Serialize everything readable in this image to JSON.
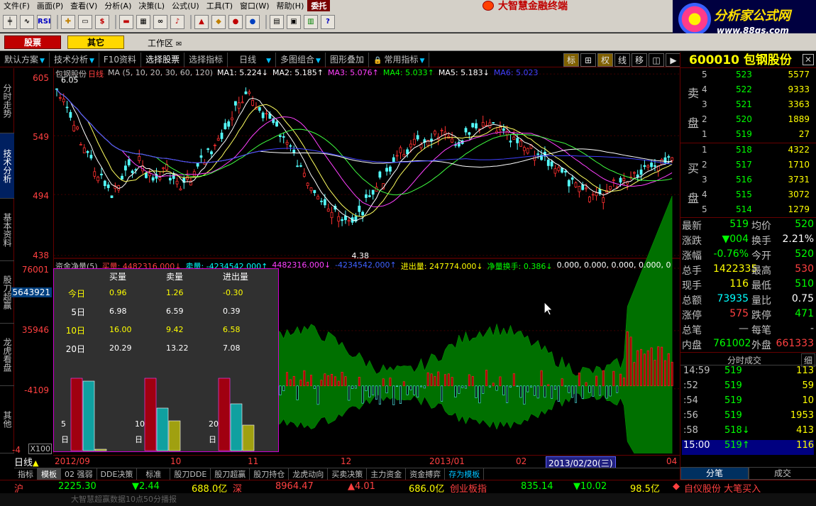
{
  "menu": [
    "文件(F)",
    "画面(P)",
    "查看(V)",
    "分析(A)",
    "决策(L)",
    "公式(U)",
    "工具(T)",
    "窗口(W)",
    "帮助(H)",
    "委托"
  ],
  "brand": "大智慧金融终端",
  "ad": {
    "title": "分析家公式网",
    "url": "www.88gs.com"
  },
  "toolbar_icons": [
    "kline-icon",
    "minute-chart-icon",
    "rsi-icon",
    "crosshair-icon",
    "ruler-icon",
    "dollar-icon",
    "bar-icon",
    "grid-icon",
    "binoculars-icon",
    "alert-icon",
    "report-icon",
    "diamond-icon",
    "pill-icon",
    "capsule-icon",
    "doc-icon",
    "window-icon",
    "books-icon",
    "help-icon"
  ],
  "toolbar_text": {
    "rsi": "RSI",
    "dollar": "$",
    "help": "?"
  },
  "top_tabs": {
    "stock": "股票",
    "other": "其它",
    "workspace": "工作区"
  },
  "function_tabs": [
    {
      "label": "默认方案",
      "dropdown": true
    },
    {
      "label": "技术分析",
      "dropdown": true
    },
    {
      "label": "F10资料",
      "dropdown": false
    },
    {
      "label": "选择股票",
      "dropdown": false
    },
    {
      "label": "选择指标",
      "dropdown": false
    },
    {
      "label": "日线",
      "dropdown": true
    },
    {
      "label": "多图组合",
      "dropdown": true
    },
    {
      "label": "图形叠加",
      "dropdown": false
    },
    {
      "label": "常用指标",
      "dropdown": true
    }
  ],
  "chart_tools": [
    "标",
    "⊞",
    "权",
    "线",
    "移",
    "◫",
    "▶"
  ],
  "left_tabs": [
    "分时走势",
    "技术分析",
    "基本资料",
    "股刀超赢",
    "龙虎看盘",
    "其他"
  ],
  "kline_header": {
    "name": "包钢股份",
    "period": "日线",
    "ma_label": "MA (5, 10, 20, 30, 60, 120)",
    "ma": [
      {
        "label": "MA1:",
        "value": "5.224↓",
        "color": "#ffffff"
      },
      {
        "label": "MA2:",
        "value": "5.185↑",
        "color": "#ffffff"
      },
      {
        "label": "MA3:",
        "value": "5.076↑",
        "color": "#ff40ff"
      },
      {
        "label": "MA4:",
        "value": "5.033↑",
        "color": "#00ff00"
      },
      {
        "label": "MA5:",
        "value": "5.183↓",
        "color": "#ffffff"
      },
      {
        "label": "MA6:",
        "value": "5.023",
        "color": "#4040ff"
      }
    ]
  },
  "price_axis": [
    "605",
    "549",
    "494",
    "438"
  ],
  "price_annotations": {
    "high": "6.05",
    "low": "4.38"
  },
  "fund_header": {
    "title": "资金净量(5)",
    "buy": "买量: 4482316.000↓",
    "sell": "卖量: -4234542.000↑",
    "v1": "4482316.000↓",
    "v2": "-4234542.000↑",
    "net": "进出量: 247774.000↓",
    "turnover": "净量换手: 0.386↓",
    "rest": "0.000, 0.000, 0.000, 0.000, 0"
  },
  "fund_axis": [
    "76001",
    "5643921",
    "35946",
    "-4109",
    "-4",
    "X100"
  ],
  "fund_stats": {
    "headers": [
      "买量",
      "卖量",
      "进出量"
    ],
    "rows": [
      {
        "label": "今日",
        "buy": "0.96",
        "sell": "1.26",
        "net": "-0.30"
      },
      {
        "label": "5日",
        "buy": "6.98",
        "sell": "6.59",
        "net": "0.39"
      },
      {
        "label": "10日",
        "buy": "16.00",
        "sell": "9.42",
        "net": "6.58"
      },
      {
        "label": "20日",
        "buy": "20.29",
        "sell": "13.22",
        "net": "7.08"
      }
    ],
    "bar_groups": [
      {
        "label": "5日"
      },
      {
        "label": "10日"
      },
      {
        "label": "20日"
      }
    ]
  },
  "date_axis": {
    "period_label": "日线",
    "dates": [
      "2012/09",
      "10",
      "11",
      "12",
      "2013/01",
      "02",
      "2013/02/20(三)",
      "04"
    ]
  },
  "bottom_tabs": [
    "指标",
    "模板",
    "02 强弱",
    "DDE决策",
    "标准",
    "股刀DDE",
    "股刀超赢",
    "股刀持仓",
    "龙虎动向",
    "买卖决策",
    "主力资金",
    "资金搏弈",
    "存为模板"
  ],
  "ticker": {
    "sh": {
      "label": "沪",
      "index": "2225.30",
      "change": "▼2.44",
      "amount": "688.0亿"
    },
    "sz": {
      "label": "深",
      "index": "8964.47",
      "change": "▲4.01",
      "amount": "686.0亿"
    },
    "cy": {
      "label": "创业板指",
      "index": "835.14",
      "change": "▼10.02",
      "amount": "98.5亿"
    },
    "alert": "自仪股份 大笔买入"
  },
  "news": "大智慧超赢数据10点50分播报",
  "quote": {
    "code": "600010",
    "name": "包钢股份",
    "sell_label": [
      "卖",
      "盘"
    ],
    "buy_label": [
      "买",
      "盘"
    ],
    "asks": [
      {
        "level": "5",
        "price": "523",
        "vol": "5577"
      },
      {
        "level": "4",
        "price": "522",
        "vol": "9333"
      },
      {
        "level": "3",
        "price": "521",
        "vol": "3363"
      },
      {
        "level": "2",
        "price": "520",
        "vol": "1889"
      },
      {
        "level": "1",
        "price": "519",
        "vol": "27"
      }
    ],
    "bids": [
      {
        "level": "1",
        "price": "518",
        "vol": "4322"
      },
      {
        "level": "2",
        "price": "517",
        "vol": "1710"
      },
      {
        "level": "3",
        "price": "516",
        "vol": "3731"
      },
      {
        "level": "4",
        "price": "515",
        "vol": "3072"
      },
      {
        "level": "5",
        "price": "514",
        "vol": "1279"
      }
    ],
    "stats": [
      {
        "l1": "最新",
        "v1": "519",
        "c1": "#00ff00",
        "l2": "均价",
        "v2": "520",
        "c2": "#00ff00"
      },
      {
        "l1": "涨跌",
        "v1": "▼004",
        "c1": "#00ff00",
        "l2": "换手",
        "v2": "2.21%",
        "c2": "#ffffff"
      },
      {
        "l1": "涨幅",
        "v1": "-0.76%",
        "c1": "#00ff00",
        "l2": "今开",
        "v2": "520",
        "c2": "#00ff00"
      },
      {
        "l1": "总手",
        "v1": "1422335",
        "c1": "#ffff00",
        "l2": "最高",
        "v2": "530",
        "c2": "#ff4040"
      },
      {
        "l1": "现手",
        "v1": "116",
        "c1": "#ffff00",
        "l2": "最低",
        "v2": "510",
        "c2": "#00ff00"
      },
      {
        "l1": "总额",
        "v1": "73935",
        "c1": "#00ffff",
        "l2": "量比",
        "v2": "0.75",
        "c2": "#ffffff"
      },
      {
        "l1": "涨停",
        "v1": "575",
        "c1": "#ff4040",
        "l2": "跌停",
        "v2": "471",
        "c2": "#00ff00"
      },
      {
        "l1": "总笔",
        "v1": "—",
        "c1": "#c0c0c0",
        "l2": "每笔",
        "v2": "-",
        "c2": "#c0c0c0"
      },
      {
        "l1": "内盘",
        "v1": "761002",
        "c1": "#00ff00",
        "l2": "外盘",
        "v2": "661333",
        "c2": "#ff4040"
      }
    ],
    "ticks_header": "分时成交",
    "ticks_header_btn": "细",
    "ticks": [
      {
        "time": "14:59",
        "price": "519",
        "vol": "113"
      },
      {
        "time": ":52",
        "price": "519",
        "vol": "59"
      },
      {
        "time": ":54",
        "price": "519",
        "vol": "10"
      },
      {
        "time": ":56",
        "price": "519",
        "vol": "1953"
      },
      {
        "time": ":58",
        "price": "518↓",
        "vol": "413"
      },
      {
        "time": "15:00",
        "price": "519↑",
        "vol": "116"
      }
    ],
    "bottom_tabs": [
      "分笔",
      "成交"
    ]
  }
}
